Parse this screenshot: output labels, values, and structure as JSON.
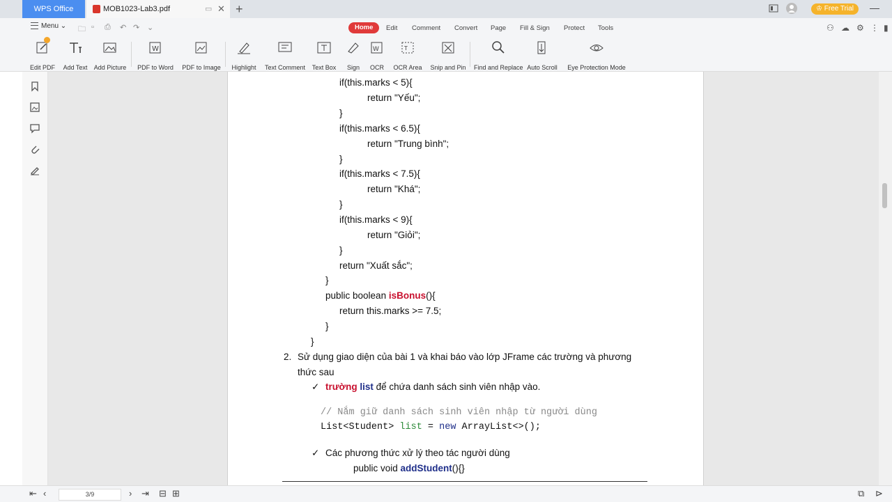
{
  "tabs": {
    "app": "WPS Office",
    "document": "MOB1023-Lab3.pdf"
  },
  "top_right": {
    "free_trial": "Free Trial"
  },
  "menu": {
    "label": "Menu"
  },
  "ribbon_tabs": [
    "Home",
    "Edit",
    "Comment",
    "Convert",
    "Page",
    "Fill & Sign",
    "Protect",
    "Tools"
  ],
  "tools": [
    {
      "label": "Edit PDF",
      "icon": "edit-pdf-icon"
    },
    {
      "label": "Add Text",
      "icon": "add-text-icon"
    },
    {
      "label": "Add Picture",
      "icon": "add-picture-icon"
    },
    {
      "label": "PDF to Word",
      "icon": "pdf-to-word-icon"
    },
    {
      "label": "PDF to Image",
      "icon": "pdf-to-image-icon"
    },
    {
      "label": "Highlight",
      "icon": "highlight-icon"
    },
    {
      "label": "Text Comment",
      "icon": "text-comment-icon"
    },
    {
      "label": "Text Box",
      "icon": "text-box-icon"
    },
    {
      "label": "Sign",
      "icon": "sign-icon"
    },
    {
      "label": "OCR",
      "icon": "ocr-icon"
    },
    {
      "label": "OCR Area",
      "icon": "ocr-area-icon"
    },
    {
      "label": "Snip and Pin",
      "icon": "snip-pin-icon"
    },
    {
      "label": "Find and Replace",
      "icon": "find-replace-icon"
    },
    {
      "label": "Auto Scroll",
      "icon": "auto-scroll-icon"
    },
    {
      "label": "Eye Protection Mode",
      "icon": "eye-icon"
    }
  ],
  "doc": {
    "code1": {
      "l1": "if(this.marks < 5){",
      "l2": "return \"Yếu\";",
      "l3": "}",
      "l4": "if(this.marks < 6.5){",
      "l5": "return \"Trung bình\";",
      "l6": "}",
      "l7": "if(this.marks < 7.5){",
      "l8": "return \"Khá\";",
      "l9": "}",
      "l10": "if(this.marks < 9){",
      "l11": "return \"Giỏi\";",
      "l12": "}",
      "l13": "return \"Xuất sắc\";",
      "l14": "}",
      "l15_pre": "public boolean ",
      "l15_name": "isBonus",
      "l15_post": "(){",
      "l16": "return this.marks >= 7.5;",
      "l17": "}",
      "l18": "}"
    },
    "item2": {
      "number": "2.",
      "line1": "Sử dụng giao diện của bài 1 và khai báo vào lớp JFrame các trường và phương",
      "line2": "thức sau"
    },
    "bullet1": {
      "check": "✓",
      "red": "trường",
      "blue": "list",
      "rest": " để chứa danh sách sinh viên nhập vào."
    },
    "snippet": {
      "comment": "// Nắm giữ danh sách sinh viên nhập từ người dùng",
      "type": "List<Student> ",
      "var": "list",
      "eq": " = ",
      "kw": "new",
      "rest": " ArrayList<>();"
    },
    "bullet2": {
      "check": "✓",
      "text": "Các phương thức xử lý theo tác người dùng",
      "sig_pre": "public void ",
      "sig_name": "addStudent",
      "sig_post": "(){}"
    }
  },
  "status": {
    "page": "3/9"
  }
}
